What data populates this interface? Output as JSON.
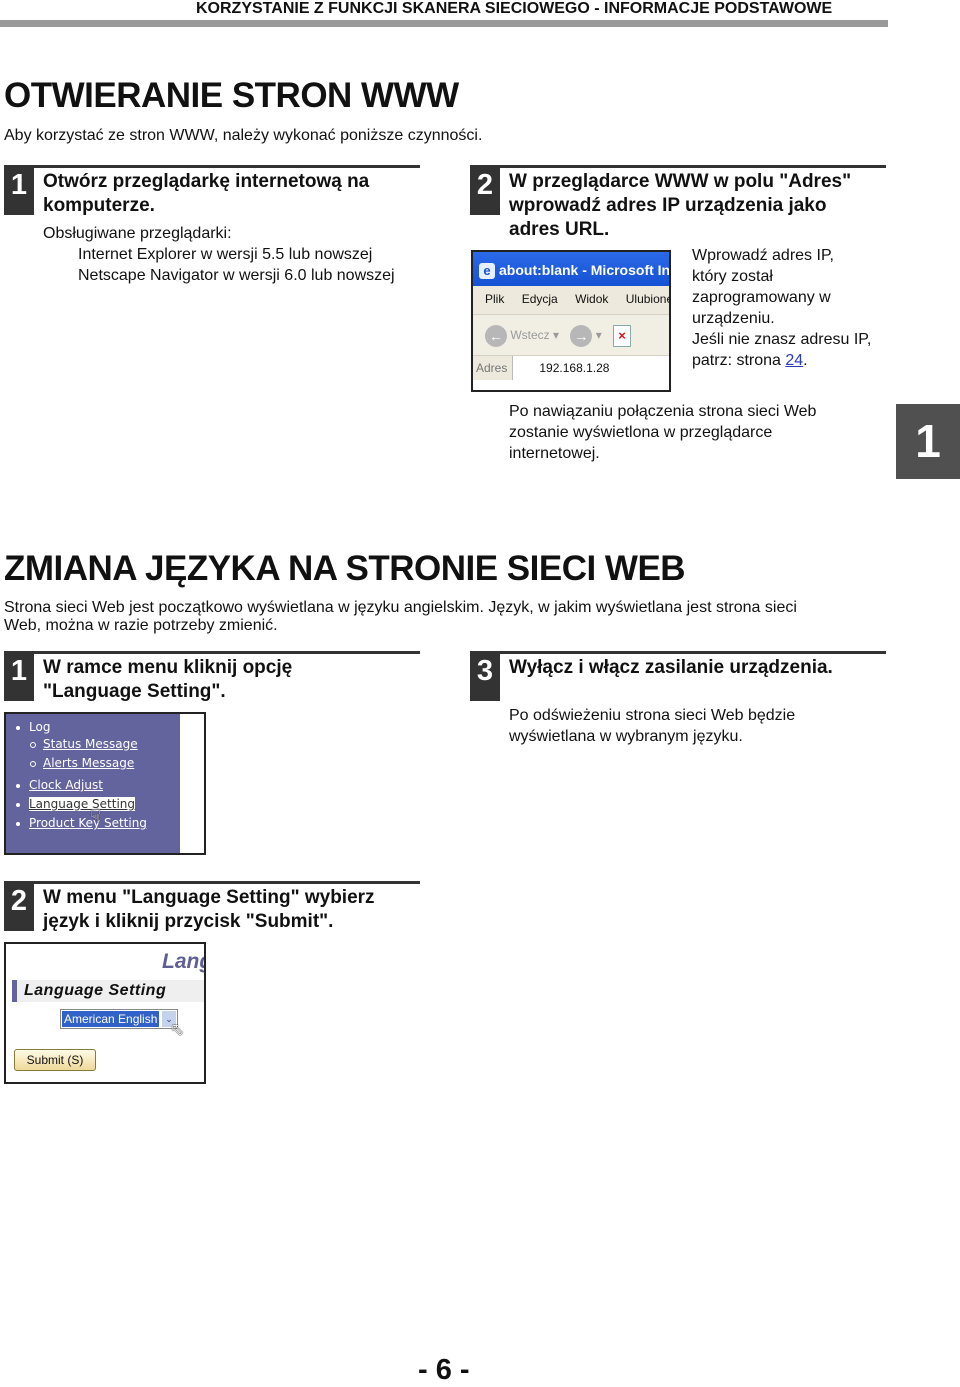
{
  "running_header": "KORZYSTANIE Z FUNKCJI SKANERA SIECIOWEGO - INFORMACJE PODSTAWOWE",
  "section1": {
    "title": "OTWIERANIE STRON WWW",
    "intro": "Aby korzystać ze stron WWW, należy wykonać poniższe czynności.",
    "step1": {
      "number": "1",
      "title_line1": "Otwórz przeglądarkę internetową na",
      "title_line2": "komputerze.",
      "supported_label": "Obsługiwane przeglądarki:",
      "browsers": [
        "Internet Explorer w wersji 5.5 lub nowszej",
        "Netscape Navigator w wersji 6.0 lub nowszej"
      ]
    },
    "step2": {
      "number": "2",
      "title_line1": "W przeglądarce WWW w polu \"Adres\"",
      "title_line2": "wprowadź adres IP urządzenia jako",
      "title_line3": "adres URL.",
      "browser_shot": {
        "title": "about:blank - Microsoft In",
        "menu": [
          "Plik",
          "Edycja",
          "Widok",
          "Ulubione"
        ],
        "back_label": "Wstecz",
        "address_label": "Adres",
        "address_value": "192.168.1.28"
      },
      "note_lines": [
        "Wprowadź adres IP,",
        "który został",
        "zaprogramowany w",
        "urządzeniu.",
        "Jeśli nie znasz adresu IP,"
      ],
      "note_ref_prefix": "patrz: strona ",
      "note_ref_page": "24",
      "note_ref_suffix": ".",
      "after_text_lines": [
        "Po nawiązaniu połączenia strona sieci Web",
        "zostanie wyświetlona w przeglądarce",
        "internetowej."
      ]
    }
  },
  "chapter_tab": "1",
  "section2": {
    "title": "ZMIANA JĘZYKA NA STRONIE SIECI WEB",
    "intro_line1": "Strona sieci Web jest początkowo wyświetlana w języku angielskim. Język, w jakim wyświetlana jest strona sieci",
    "intro_line2": "Web, można w razie potrzeby zmienić.",
    "step1": {
      "number": "1",
      "title_line1": "W ramce menu kliknij opcję",
      "title_line2": "\"Language Setting\".",
      "menu_items": [
        "Log",
        "Status Message",
        "Alerts Message",
        "Clock Adjust",
        "Language Setting",
        "Product Key Setting"
      ]
    },
    "step2": {
      "number": "2",
      "title_line1": "W menu \"Language Setting\" wybierz",
      "title_line2": "język i kliknij przycisk \"Submit\".",
      "lang_shot": {
        "banner": "Lang",
        "heading": "Language Setting",
        "selected_language": "American English",
        "submit_label": "Submit (S)"
      }
    },
    "step3": {
      "number": "3",
      "title": "Wyłącz i włącz zasilanie urządzenia.",
      "text_line1": "Po odświeżeniu strona sieci Web będzie",
      "text_line2": "wyświetlana w wybranym języku."
    }
  },
  "page_number": "- 6 -"
}
